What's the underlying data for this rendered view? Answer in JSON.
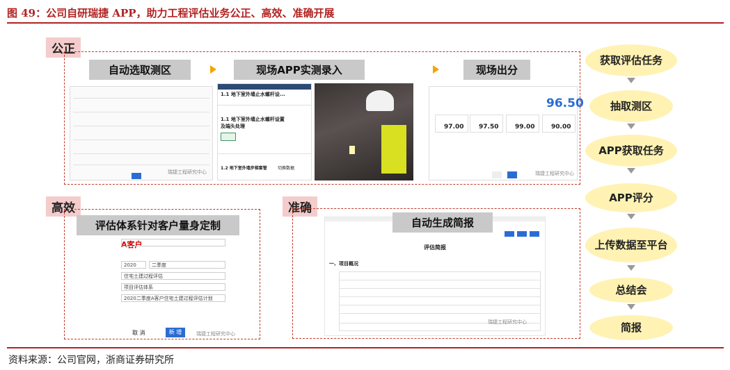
{
  "figure": {
    "title": "图 49：公司自研瑞捷 APP，助力工程评估业务公正、高效、准确开展",
    "source": "资料来源：公司官网，浙商证券研究所"
  },
  "sections": {
    "fair": {
      "label": "公正",
      "step1": "自动选取测区",
      "step2": "现场APP实测录入",
      "step3": "现场出分",
      "app_header": "1.1 地下室外墙止水螺杆设...",
      "app_item": "1.1 地下室外墙止水螺杆设置及端头处理",
      "app_next": "1.2 地下室外墙步梯套管",
      "app_btn": "切换数据",
      "total_score": "96.50",
      "scores": [
        "97.00",
        "97.50",
        "99.00",
        "90.00"
      ],
      "watermark": "瑞捷工程研究中心"
    },
    "efficient": {
      "label": "高效",
      "header": "评估体系针对客户量身定制",
      "client": "A客户",
      "year": "2020",
      "quarter": "二季度",
      "product": "住宅土建过程评估",
      "system": "项目评估体系",
      "plan_name": "2020二季度A客户住宅土建过程评估计划",
      "cancel": "取 消",
      "confirm": "新 增",
      "watermark": "瑞捷工程研究中心"
    },
    "accurate": {
      "label": "准确",
      "header": "自动生成简报",
      "report_title": "评估简报",
      "section1": "一、项目概况",
      "watermark": "瑞捷工程研究中心"
    }
  },
  "flow": [
    "获取评估任务",
    "抽取测区",
    "APP获取任务",
    "APP评分",
    "上传数据至平台",
    "总结会",
    "简报"
  ]
}
